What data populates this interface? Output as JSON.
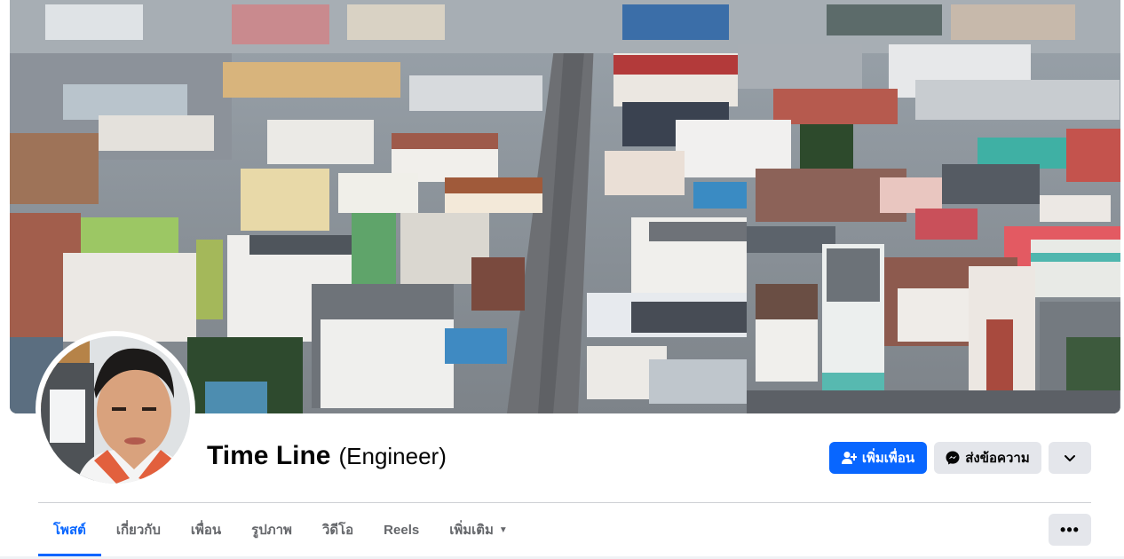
{
  "profile": {
    "name": "Time Line",
    "alternate_name": "(Engineer)"
  },
  "actions": {
    "add_friend_label": "เพิ่มเพื่อน",
    "add_friend_icon": "person-plus-icon",
    "message_label": "ส่งข้อความ",
    "message_icon": "messenger-icon",
    "more_icon": "chevron-down-icon"
  },
  "tabs": [
    {
      "label": "โพสต์",
      "active": true
    },
    {
      "label": "เกี่ยวกับ"
    },
    {
      "label": "เพื่อน"
    },
    {
      "label": "รูปภาพ"
    },
    {
      "label": "วิดีโอ"
    },
    {
      "label": "Reels"
    },
    {
      "label": "เพิ่มเติม",
      "caret": "▼"
    }
  ],
  "tab_menu_button": "•••",
  "colors": {
    "accent": "#0866ff",
    "secondary_button": "#e4e6eb",
    "muted_text": "#65676b"
  }
}
